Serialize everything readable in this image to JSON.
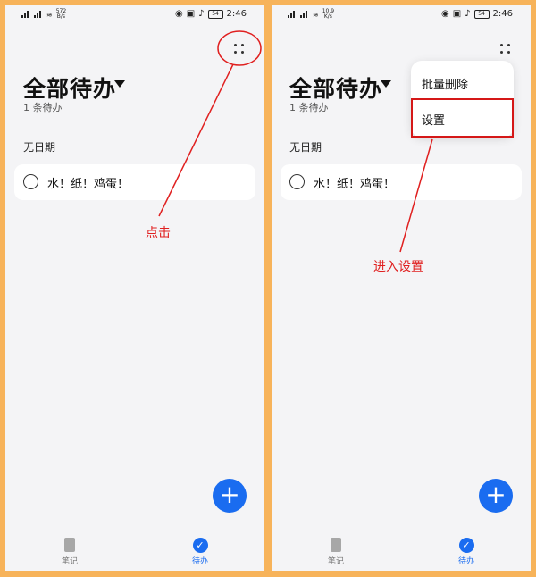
{
  "status_bar": {
    "left_net_speed_1": "572\nB/s",
    "left_net_speed_2": "10.9\nK/s",
    "time": "2:46",
    "battery": "54"
  },
  "panels": {
    "left": {
      "title": "全部待办",
      "count": "1 条待办",
      "section": "无日期",
      "todo_item": "水！纸！鸡蛋！",
      "annotation": "点击"
    },
    "right": {
      "title": "全部待办",
      "count": "1 条待办",
      "section": "无日期",
      "todo_item": "水！纸！鸡蛋！",
      "annotation": "进入设置",
      "menu": {
        "items": [
          "批量删除",
          "设置"
        ]
      }
    }
  },
  "nav": {
    "notes_label": "笔记",
    "todo_label": "待办"
  },
  "colors": {
    "frame": "#f7b35a",
    "accent": "#1a6cf0",
    "annotation": "#e02020"
  },
  "fab_symbol": "+"
}
